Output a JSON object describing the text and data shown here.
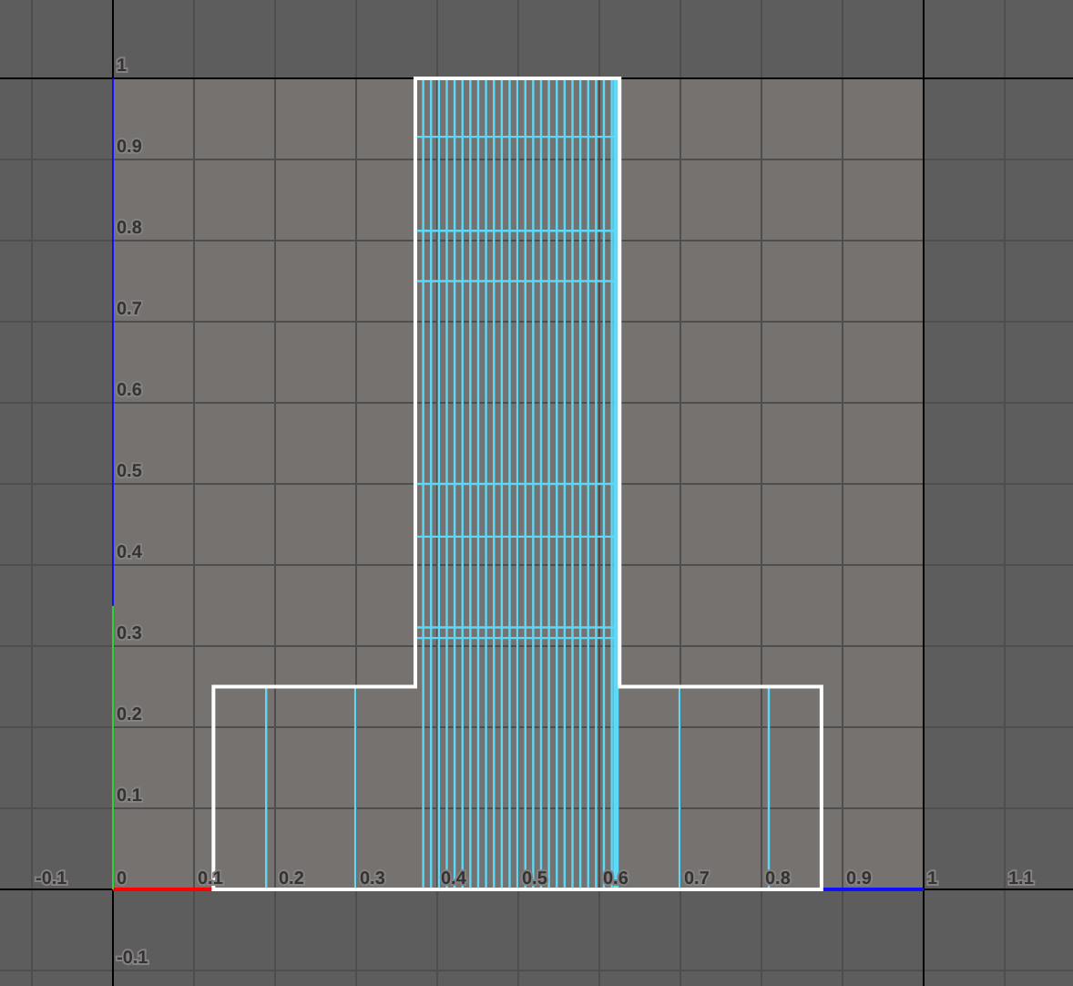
{
  "u_axis_labels": [
    "-0.1",
    "0",
    "0.1",
    "0.2",
    "0.3",
    "0.4",
    "0.5",
    "0.6",
    "0.7",
    "0.8",
    "0.9",
    "1",
    "1.1"
  ],
  "v_axis_labels": [
    "1",
    "0.9",
    "0.8",
    "0.7",
    "0.6",
    "0.5",
    "0.4",
    "0.3",
    "0.2",
    "0.1",
    "-0.1"
  ]
}
